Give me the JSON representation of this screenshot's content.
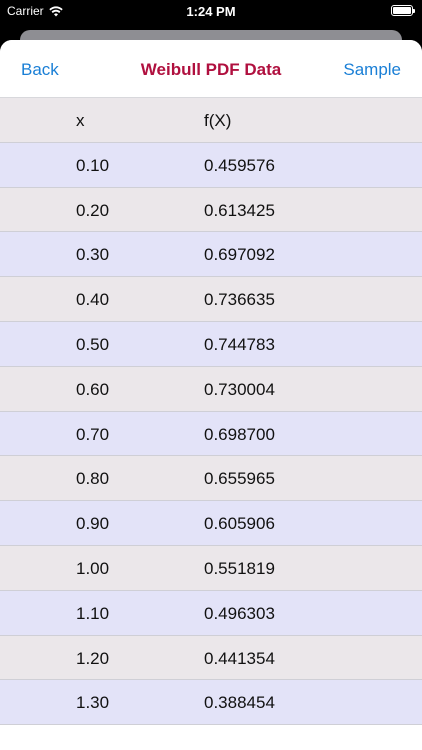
{
  "status": {
    "carrier": "Carrier",
    "time": "1:24 PM"
  },
  "nav": {
    "back_label": "Back",
    "title": "Weibull PDF Data",
    "sample_label": "Sample"
  },
  "table": {
    "headers": [
      "x",
      "f(X)"
    ],
    "rows": [
      [
        "0.10",
        "0.459576"
      ],
      [
        "0.20",
        "0.613425"
      ],
      [
        "0.30",
        "0.697092"
      ],
      [
        "0.40",
        "0.736635"
      ],
      [
        "0.50",
        "0.744783"
      ],
      [
        "0.60",
        "0.730004"
      ],
      [
        "0.70",
        "0.698700"
      ],
      [
        "0.80",
        "0.655965"
      ],
      [
        "0.90",
        "0.605906"
      ],
      [
        "1.00",
        "0.551819"
      ],
      [
        "1.10",
        "0.496303"
      ],
      [
        "1.20",
        "0.441354"
      ],
      [
        "1.30",
        "0.388454"
      ]
    ]
  },
  "colors": {
    "accent": "#1a7fd6",
    "title": "#b0103f",
    "row_odd": "#ebe7ea",
    "row_even": "#e3e3f8"
  }
}
